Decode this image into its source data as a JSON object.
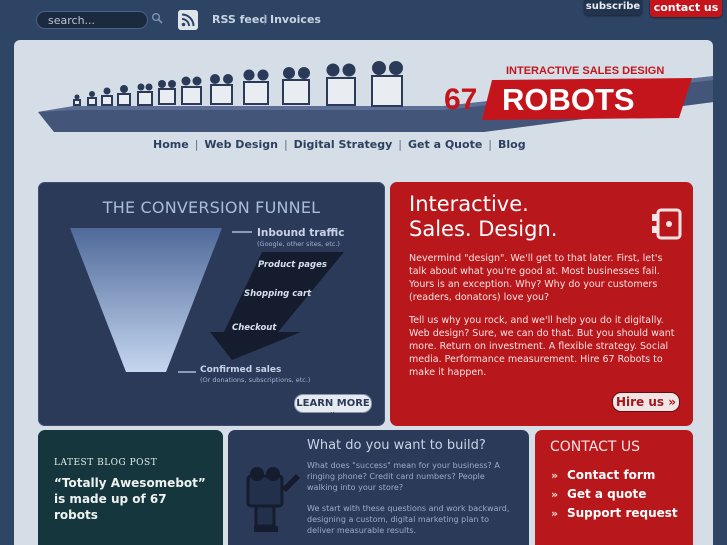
{
  "topbar": {
    "search_placeholder": "search...",
    "rss_label": "RSS feed",
    "separator": "|",
    "invoices_label": "Invoices",
    "subscribe_label": "subscribe",
    "contact_label": "contact us"
  },
  "logo": {
    "tagline": "INTERACTIVE SALES DESIGN",
    "number": "67",
    "name": "ROBOTS"
  },
  "nav": {
    "items": [
      "Home",
      "Web Design",
      "Digital Strategy",
      "Get a Quote",
      "Blog"
    ]
  },
  "funnel": {
    "title": "THE CONVERSION FUNNEL",
    "inbound": "Inbound traffic",
    "inbound_sub": "(Google, other sites, etc.)",
    "steps": [
      "Product pages",
      "Shopping cart",
      "Checkout"
    ],
    "confirmed": "Confirmed sales",
    "confirmed_sub": "(Or donations, subscriptions, etc.)",
    "learn_more": "LEARN MORE »"
  },
  "interactive": {
    "title_line1": "Interactive.",
    "title_line2": "Sales. Design.",
    "p1": "Nevermind \"design\". We'll get to that later. First, let's talk about what you're good at. Most businesses fail. Yours is an exception. Why? Why do your customers (readers, donators) love you?",
    "p2": "Tell us why you rock, and we'll help you do it digitally. Web design? Sure, we can do that. But you should want more. Return on investment. A flexible strategy. Social media. Performance measurement. Hire 67 Robots to make it happen.",
    "hire_label": "Hire us »"
  },
  "blog": {
    "heading": "LATEST BLOG POST",
    "title": "“Totally Awesomebot” is made up of 67 robots"
  },
  "build": {
    "title": "What do you want to build?",
    "p1": "What does \"success\" mean for your business? A ringing phone? Credit card numbers? People walking into your store?",
    "p2": "We start with these questions and work backward, designing a custom, digital marketing plan to deliver measurable results."
  },
  "contact": {
    "title": "CONTACT US",
    "items": [
      "Contact form",
      "Get a quote",
      "Support request"
    ],
    "chevron": "»"
  },
  "colors": {
    "navy": "#2c3a5a",
    "red": "#b8181c",
    "page_bg": "#d5dde6",
    "teal": "#16363d"
  }
}
